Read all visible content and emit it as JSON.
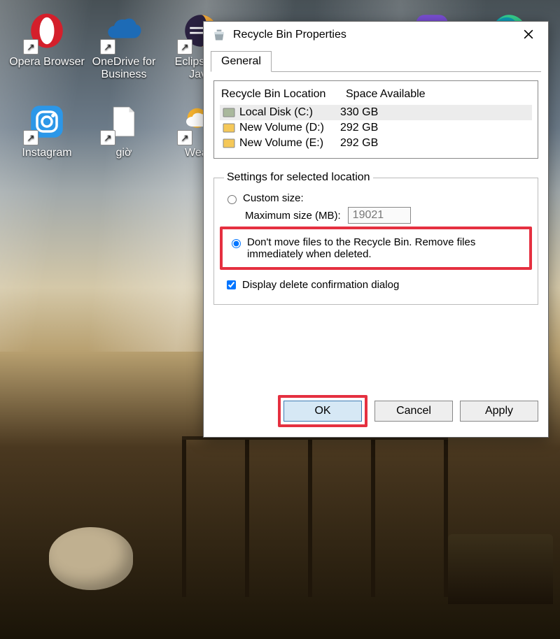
{
  "desktop_icons": [
    {
      "name": "opera",
      "label": "Opera Browser",
      "color": "#d41f2b"
    },
    {
      "name": "onedrive",
      "label": "OneDrive for Business",
      "color": "#1d6bb6"
    },
    {
      "name": "eclipse",
      "label": "Eclipse for Java",
      "color": "#2a2140"
    },
    {
      "name": "folder",
      "label": "",
      "color": "#f5c858"
    },
    {
      "name": "recycle",
      "label": "",
      "color": "#c0d0d8"
    },
    {
      "name": "viber",
      "label": "",
      "color": "#7b4fd6"
    },
    {
      "name": "edge",
      "label": "",
      "color": "#0fa0b8"
    },
    {
      "name": "instagram",
      "label": "Instagram",
      "color": "#2c97e8"
    },
    {
      "name": "textfile",
      "label": "giờ",
      "color": "#ffffff"
    },
    {
      "name": "weather",
      "label": "Weath",
      "color": "#f5b22e"
    }
  ],
  "dialog": {
    "title": "Recycle Bin Properties",
    "tab": "General",
    "list": {
      "headers": {
        "c1": "Recycle Bin Location",
        "c2": "Space Available"
      },
      "rows": [
        {
          "name": "Local Disk (C:)",
          "space": "330 GB",
          "selected": true,
          "color": "#a9b89c"
        },
        {
          "name": "New Volume (D:)",
          "space": "292 GB",
          "selected": false,
          "color": "#f5c858"
        },
        {
          "name": "New Volume (E:)",
          "space": "292 GB",
          "selected": false,
          "color": "#f5c858"
        }
      ]
    },
    "settings_legend": "Settings for selected location",
    "custom_label": "Custom size:",
    "max_label": "Maximum size (MB):",
    "max_value": "19021",
    "dont_move_label": "Don't move files to the Recycle Bin. Remove files immediately when deleted.",
    "confirm_label": "Display delete confirmation dialog",
    "buttons": {
      "ok": "OK",
      "cancel": "Cancel",
      "apply": "Apply"
    }
  }
}
